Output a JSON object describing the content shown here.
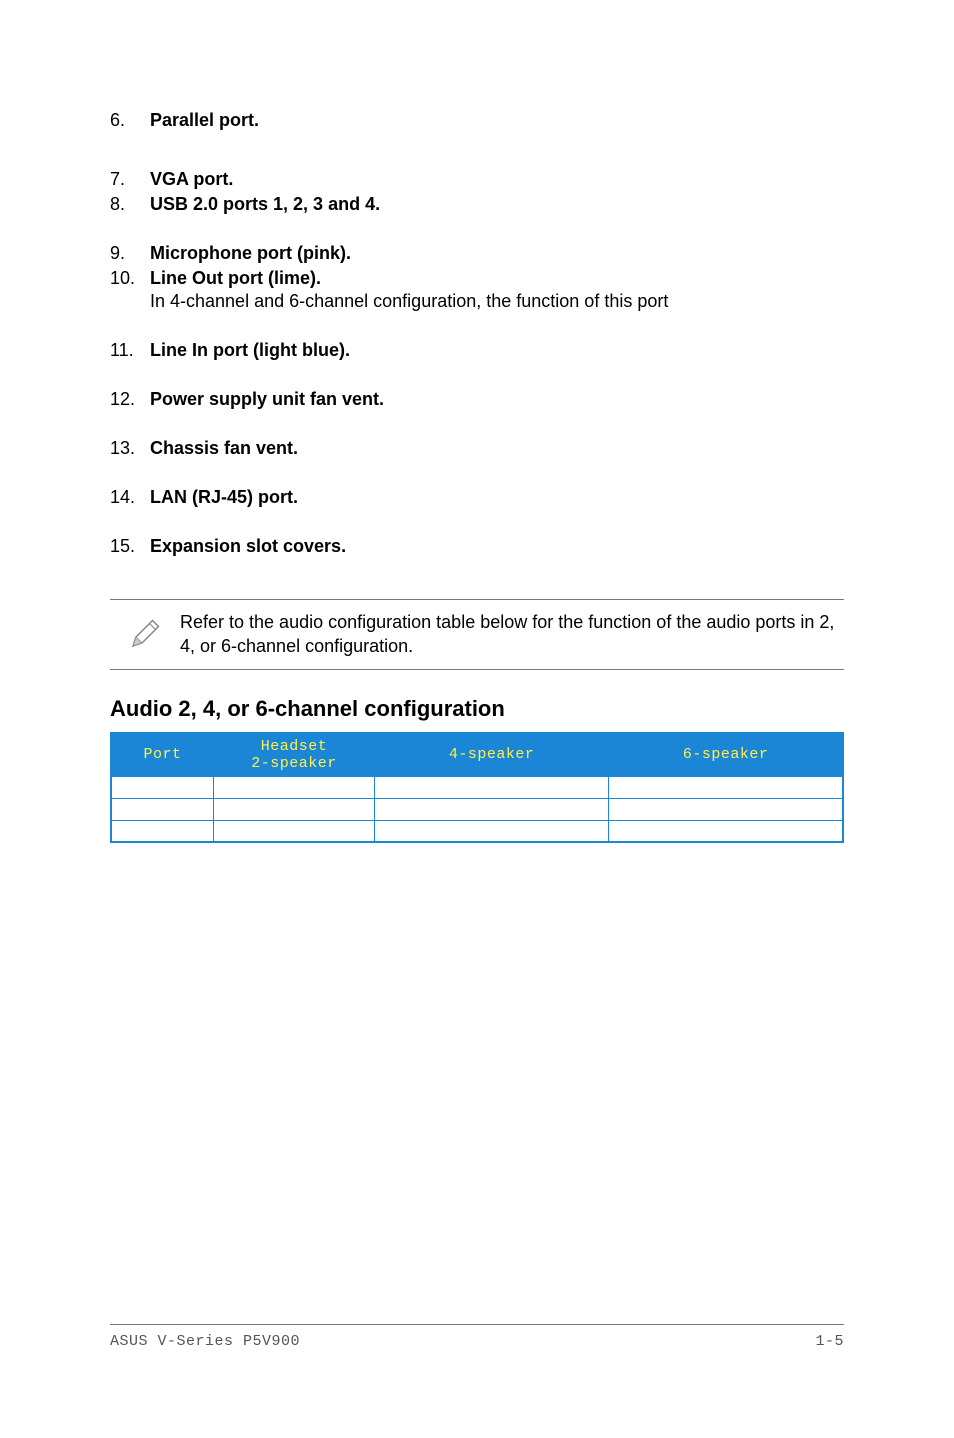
{
  "items": [
    {
      "num": "6.",
      "label": "Parallel port.",
      "desc": ""
    },
    {
      "num": "7.",
      "label": "VGA port.",
      "desc": ""
    },
    {
      "num": "8.",
      "label": "USB 2.0 ports 1, 2, 3 and 4.",
      "desc": ""
    },
    {
      "num": "9.",
      "label": "Microphone port (pink).",
      "desc": ""
    },
    {
      "num": "10.",
      "label": "Line Out port (lime).",
      "desc": "",
      "sub": "In 4-channel and 6-channel configuration, the function of this port"
    },
    {
      "num": "11.",
      "label": "Line In port (light blue).",
      "desc": ""
    },
    {
      "num": "12.",
      "label": "Power supply unit fan vent.",
      "desc": ""
    },
    {
      "num": "13.",
      "label": "Chassis fan vent.",
      "desc": ""
    },
    {
      "num": "14.",
      "label": "LAN (RJ-45) port.",
      "desc": ""
    },
    {
      "num": "15.",
      "label": "Expansion slot covers.",
      "desc": ""
    }
  ],
  "note": "Refer to the audio configuration table below for the function of the audio ports in 2, 4, or 6-channel configuration.",
  "section_title": "Audio 2, 4, or 6-channel configuration",
  "table_headers": {
    "h1": "Port",
    "h2": "Headset\n2-speaker",
    "h3": "4-speaker",
    "h4": "6-speaker"
  },
  "footer_left": "ASUS V-Series P5V900",
  "footer_right": "1-5"
}
